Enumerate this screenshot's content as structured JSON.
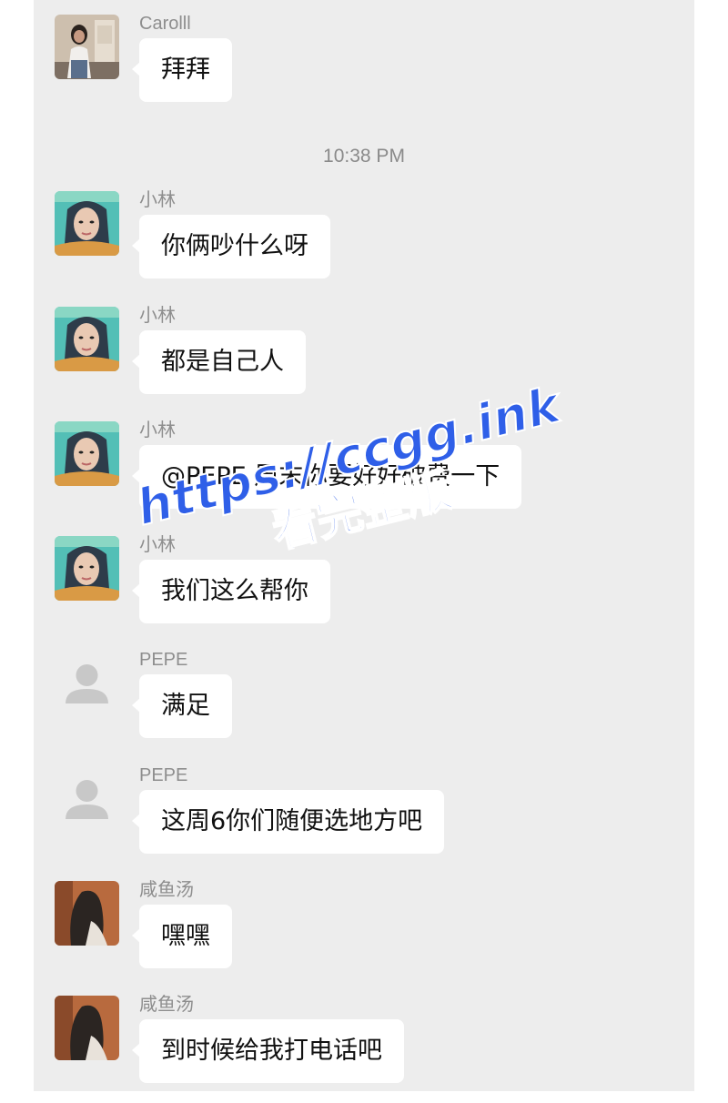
{
  "chat": {
    "timestamp": "10:38 PM",
    "messages": [
      {
        "sender": "Carolll",
        "text": "拜拜",
        "avatar_icon": "avatar-carolll-photo"
      },
      {
        "sender": "小林",
        "text": "你俩吵什么呀",
        "avatar_icon": "avatar-xiaolin-photo"
      },
      {
        "sender": "小林",
        "text": "都是自己人",
        "avatar_icon": "avatar-xiaolin-photo"
      },
      {
        "sender": "小林",
        "text": "@PEPE 周末你要好好破费一下",
        "avatar_icon": "avatar-xiaolin-photo"
      },
      {
        "sender": "小林",
        "text": "我们这么帮你",
        "avatar_icon": "avatar-xiaolin-photo"
      },
      {
        "sender": "PEPE",
        "text": "满足",
        "avatar_icon": "default-person-icon"
      },
      {
        "sender": "PEPE",
        "text": "这周6你们随便选地方吧",
        "avatar_icon": "default-person-icon"
      },
      {
        "sender": "咸鱼汤",
        "text": "嘿嘿",
        "avatar_icon": "avatar-xianyutang-photo"
      },
      {
        "sender": "咸鱼汤",
        "text": "到时候给我打电话吧",
        "avatar_icon": "avatar-xianyutang-photo"
      }
    ]
  },
  "watermark": {
    "line1": "https://ccgg.ink",
    "line2": "看完整版"
  },
  "colors": {
    "chat_background": "#ededed",
    "bubble": "#ffffff",
    "sender_name": "#8e8e8e",
    "watermark": "#2f5fe8"
  }
}
